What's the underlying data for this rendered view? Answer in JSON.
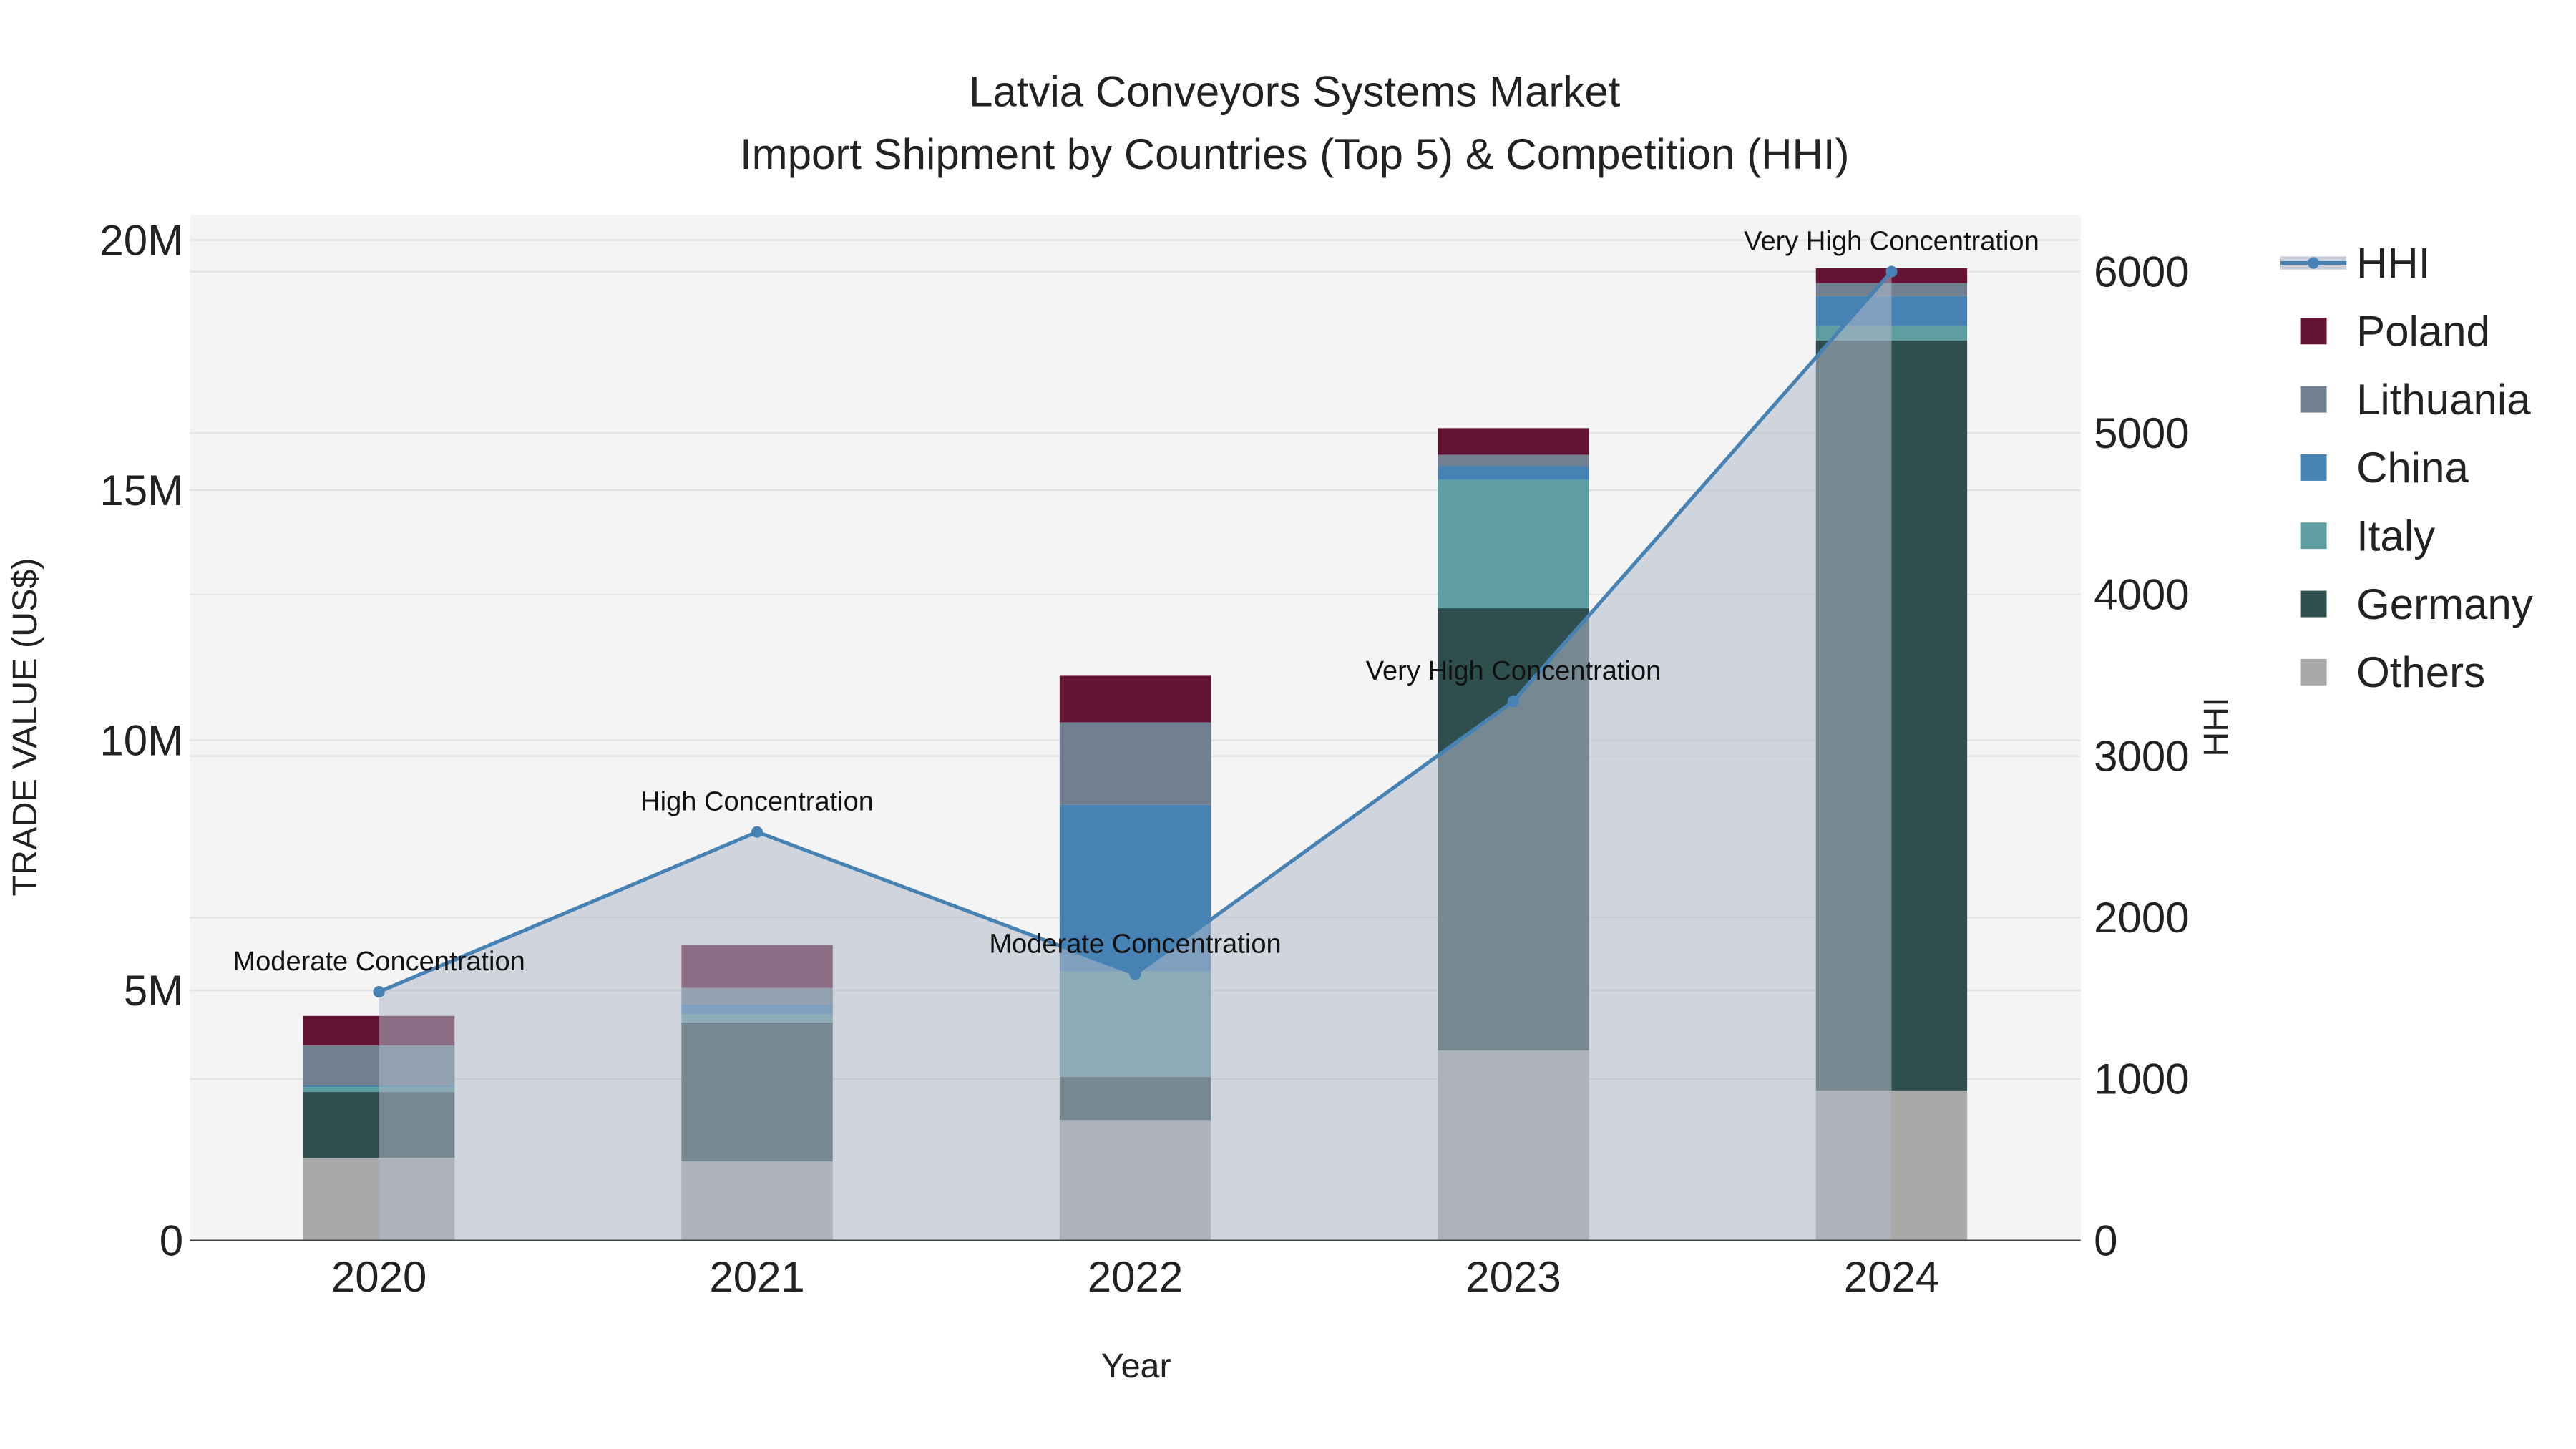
{
  "chart_data": {
    "type": "bar",
    "title_line1": "Latvia Conveyors Systems Market",
    "title_line2": "Import Shipment by Countries (Top 5) & Competition (HHI)",
    "xlabel": "Year",
    "ylabel": "TRADE VALUE (US$)",
    "y2label": "HHI",
    "categories": [
      "2020",
      "2021",
      "2022",
      "2023",
      "2024"
    ],
    "ylim": [
      0,
      20500000
    ],
    "y2lim": [
      0,
      6350
    ],
    "yticks": [
      {
        "v": 0,
        "label": "0"
      },
      {
        "v": 5000000,
        "label": "5M"
      },
      {
        "v": 10000000,
        "label": "10M"
      },
      {
        "v": 15000000,
        "label": "15M"
      },
      {
        "v": 20000000,
        "label": "20M"
      }
    ],
    "y2ticks": [
      {
        "v": 0,
        "label": "0"
      },
      {
        "v": 1000,
        "label": "1000"
      },
      {
        "v": 2000,
        "label": "2000"
      },
      {
        "v": 3000,
        "label": "3000"
      },
      {
        "v": 4000,
        "label": "4000"
      },
      {
        "v": 5000,
        "label": "5000"
      },
      {
        "v": 6000,
        "label": "6000"
      }
    ],
    "series": [
      {
        "name": "Others",
        "color": "#A9A9A9",
        "values": [
          1650000,
          1580000,
          2410000,
          3800000,
          3000000
        ]
      },
      {
        "name": "Germany",
        "color": "#2F4F4F",
        "values": [
          1320000,
          2780000,
          860000,
          8840000,
          14990000
        ]
      },
      {
        "name": "Italy",
        "color": "#5F9EA0",
        "values": [
          100000,
          160000,
          2110000,
          2570000,
          290000
        ]
      },
      {
        "name": "China",
        "color": "#4682B4",
        "values": [
          30000,
          200000,
          3330000,
          270000,
          600000
        ]
      },
      {
        "name": "Lithuania",
        "color": "#708090",
        "values": [
          800000,
          330000,
          1650000,
          230000,
          260000
        ]
      },
      {
        "name": "Poland",
        "color": "#641334",
        "values": [
          590000,
          860000,
          930000,
          530000,
          300000
        ]
      }
    ],
    "hhi": {
      "name": "HHI",
      "color": "#4682B4",
      "values": [
        1540,
        2530,
        1650,
        3340,
        6000
      ],
      "annotations": [
        "Moderate Concentration",
        "High Concentration",
        "Moderate Concentration",
        "Very High Concentration",
        "Very High Concentration"
      ]
    },
    "legend": [
      "HHI",
      "Poland",
      "Lithuania",
      "China",
      "Italy",
      "Germany",
      "Others"
    ],
    "legend_placement": "right"
  }
}
